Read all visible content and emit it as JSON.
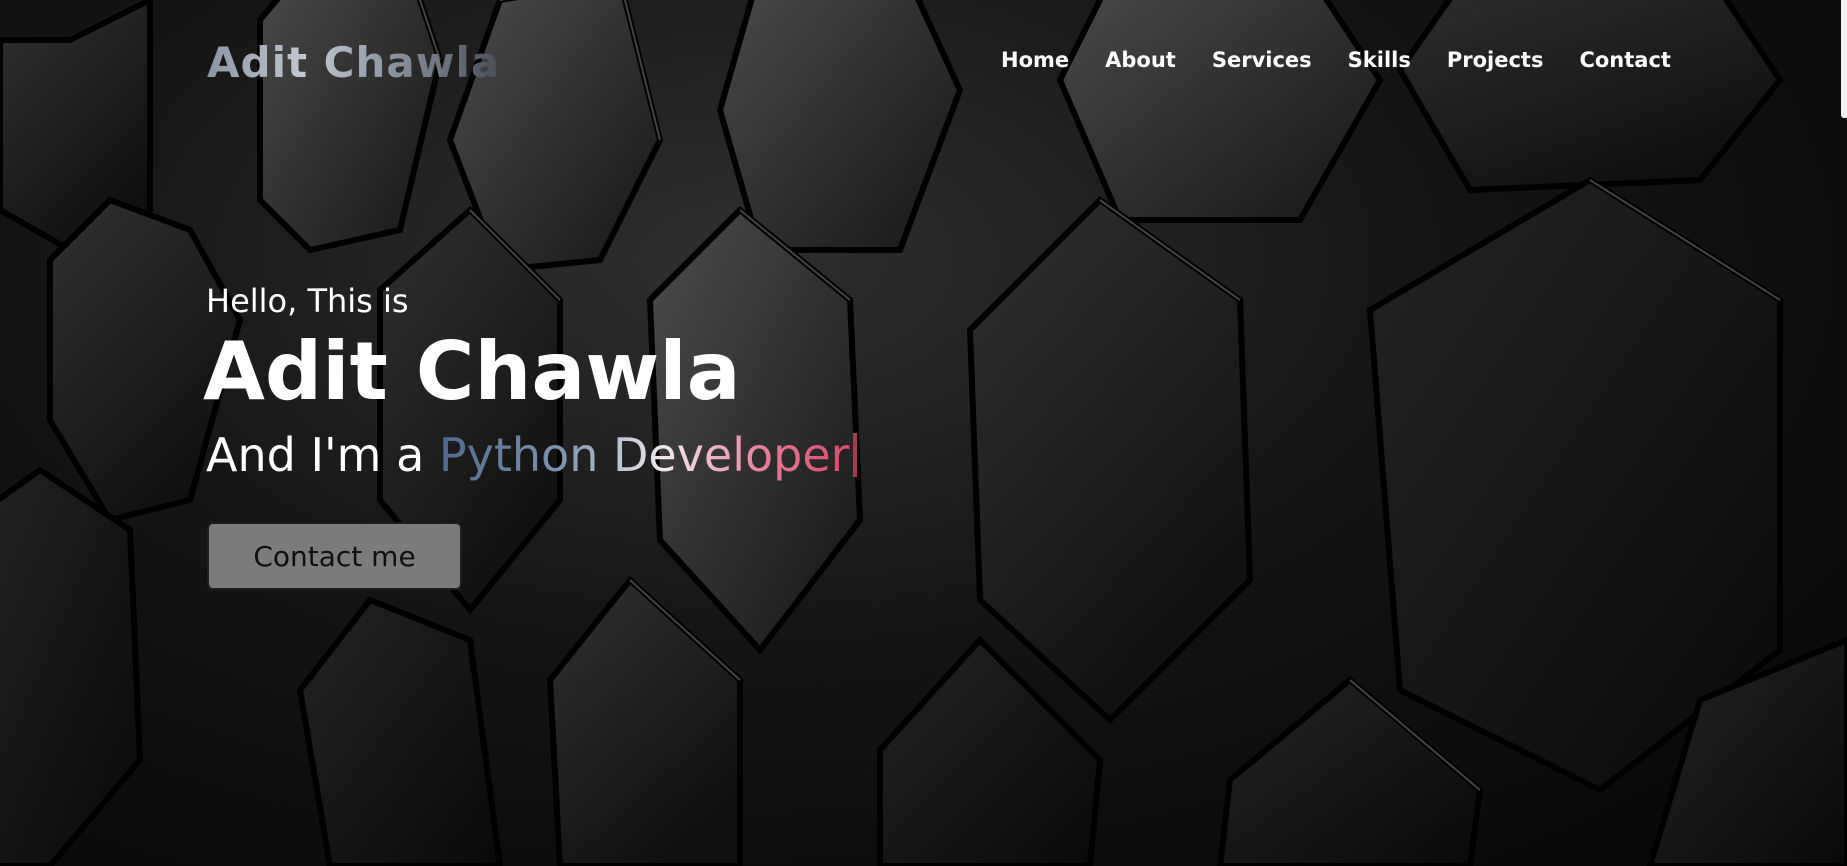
{
  "brand": {
    "logo_text": "Adit Chawla"
  },
  "nav": {
    "items": [
      {
        "label": "Home"
      },
      {
        "label": "About"
      },
      {
        "label": "Services"
      },
      {
        "label": "Skills"
      },
      {
        "label": "Projects"
      },
      {
        "label": "Contact"
      }
    ]
  },
  "hero": {
    "greeting": "Hello, This is",
    "name": "Adit Chawla",
    "role_prefix": "And I'm a ",
    "role_typed": "Python Developer",
    "cta_label": "Contact me"
  },
  "colors": {
    "nav_text": "#ffffff",
    "button_bg": "#7b7b7b",
    "typed_gradient_start": "#4f6a8c",
    "typed_gradient_end": "#d64a6a",
    "caret": "#b03551"
  },
  "icons": {
    "background": "hexagon-pattern"
  }
}
